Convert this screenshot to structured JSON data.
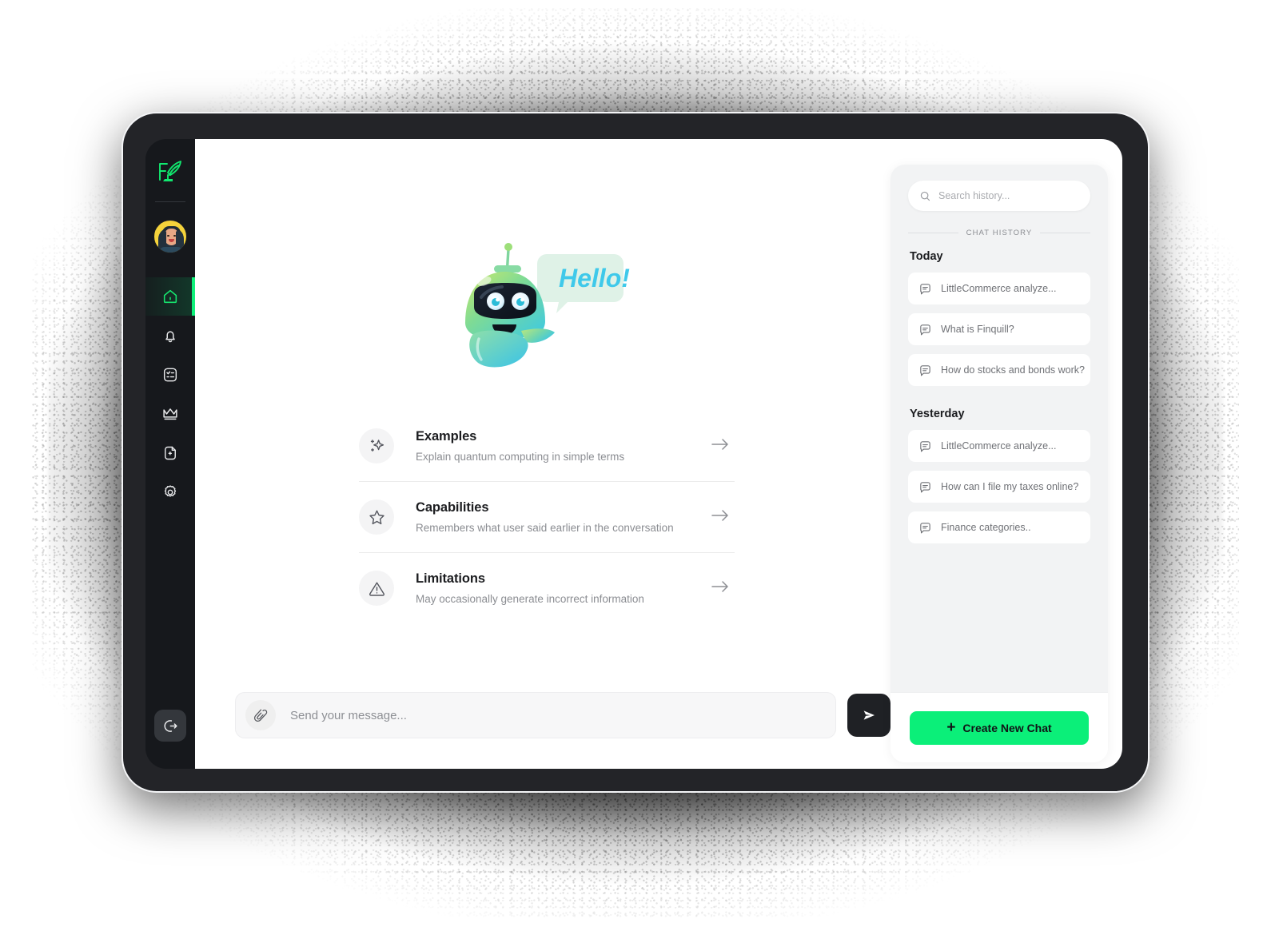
{
  "app": {
    "logo_icon": "quill-pen-logo",
    "accent_color": "#0bef79",
    "sidebar_bg": "#16181c",
    "dark_button": "#1f2125"
  },
  "sidebar": {
    "avatar_name": "user-avatar",
    "items": [
      {
        "label": "Home",
        "icon": "home-icon",
        "active": true
      },
      {
        "label": "Notifications",
        "icon": "bell-icon",
        "active": false
      },
      {
        "label": "Tasks",
        "icon": "checklist-icon",
        "active": false
      },
      {
        "label": "Premium",
        "icon": "crown-icon",
        "active": false
      },
      {
        "label": "New Document",
        "icon": "file-plus-icon",
        "active": false
      },
      {
        "label": "Settings",
        "icon": "gear-icon",
        "active": false
      }
    ],
    "logout": {
      "label": "Log out",
      "icon": "logout-icon"
    }
  },
  "hero": {
    "bubble_text": "Hello!",
    "robot_icon": "robot-mascot",
    "bubble_bg": "#dff2e6",
    "bubble_text_color": "#3ec8e8"
  },
  "cards": [
    {
      "title": "Examples",
      "subtitle": "Explain quantum computing in simple terms",
      "icon": "sparkle-icon",
      "arrow": "arrow-right-icon"
    },
    {
      "title": "Capabilities",
      "subtitle": "Remembers what user said earlier in the conversation",
      "icon": "star-outline-icon",
      "arrow": "arrow-right-icon"
    },
    {
      "title": "Limitations",
      "subtitle": "May occasionally generate incorrect information",
      "icon": "warning-triangle-icon",
      "arrow": "arrow-right-icon"
    }
  ],
  "composer": {
    "attach_icon": "paperclip-icon",
    "placeholder": "Send your message...",
    "value": "",
    "send_icon": "send-plane-icon"
  },
  "history": {
    "search": {
      "placeholder": "Search history...",
      "value": "",
      "icon": "search-icon"
    },
    "divider_label": "CHAT HISTORY",
    "groups": [
      {
        "label": "Today",
        "items": [
          {
            "text": "LittleCommerce analyze...",
            "icon": "chat-bubble-icon"
          },
          {
            "text": "What is Finquill?",
            "icon": "chat-bubble-icon"
          },
          {
            "text": "How do stocks and bonds work?",
            "icon": "chat-bubble-icon"
          }
        ]
      },
      {
        "label": "Yesterday",
        "items": [
          {
            "text": "LittleCommerce analyze...",
            "icon": "chat-bubble-icon"
          },
          {
            "text": "How can I file my taxes online?",
            "icon": "chat-bubble-icon"
          },
          {
            "text": "Finance categories..",
            "icon": "chat-bubble-icon"
          }
        ]
      }
    ],
    "new_chat": {
      "label": "Create New Chat",
      "plus": "+",
      "icon": "plus-icon"
    }
  }
}
